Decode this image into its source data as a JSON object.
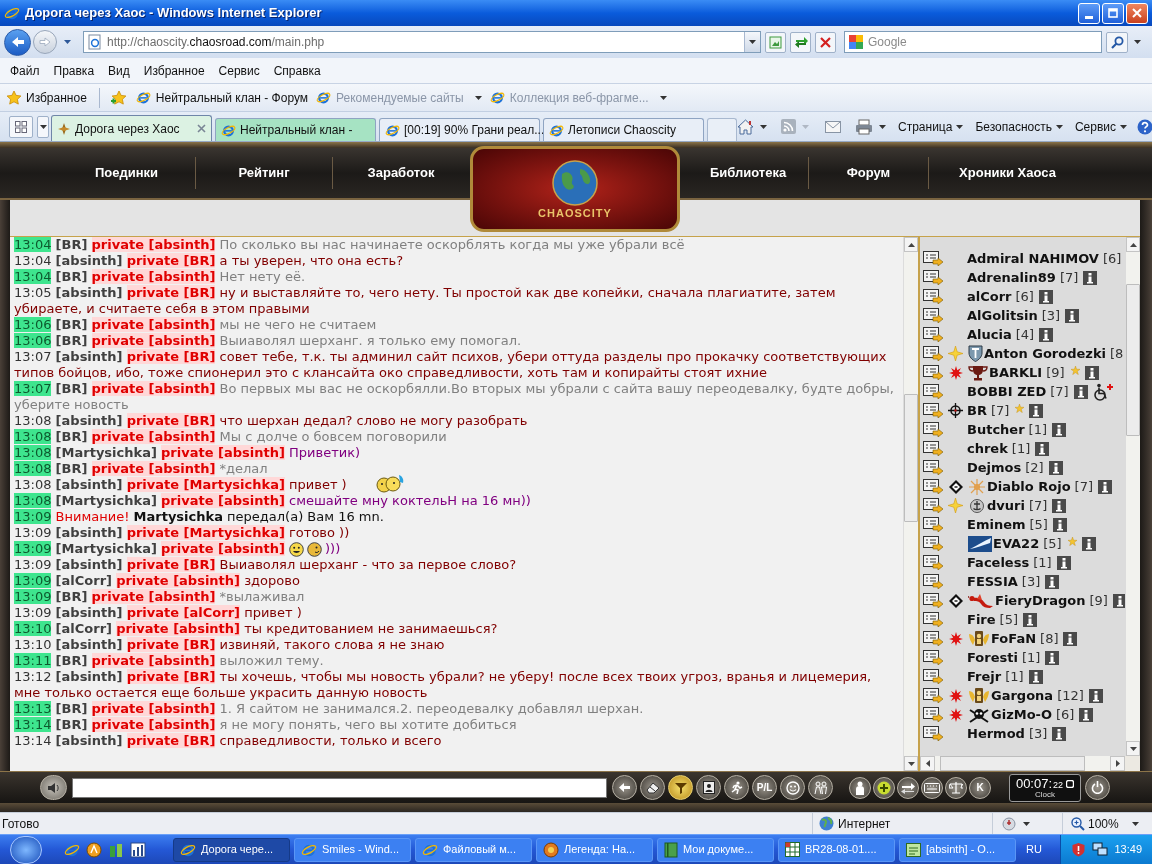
{
  "window": {
    "title": "Дорога через Хаос - Windows Internet Explorer"
  },
  "address_bar": {
    "url": {
      "start": "http://chaoscity.",
      "domain": "chaosroad.com",
      "path": "/main.php"
    },
    "search": {
      "placeholder": "Google"
    }
  },
  "menu": [
    "Файл",
    "Правка",
    "Вид",
    "Избранное",
    "Сервис",
    "Справка"
  ],
  "favorites_bar": {
    "favorites_button": "Избранное",
    "links": [
      {
        "label": "Нейтральный клан - Форум",
        "disabled": false,
        "dropdown": false
      },
      {
        "label": "Рекомендуемые сайты",
        "disabled": true,
        "dropdown": true
      },
      {
        "label": "Коллекция веб-фрагме...",
        "disabled": true,
        "dropdown": true
      }
    ]
  },
  "tabs": [
    {
      "label": "Дорога через Хаос",
      "selected": true,
      "color": "#dcf2e3"
    },
    {
      "label": "Нейтральный клан -",
      "selected": false,
      "color": "#a6e3c3"
    },
    {
      "label": "[00:19] 90% Грани реал...",
      "selected": false,
      "color": "#e8eef7"
    },
    {
      "label": "Летописи Chaoscity",
      "selected": false,
      "color": "#e8eef7"
    }
  ],
  "command_bar": [
    "Страница",
    "Безопасность",
    "Сервис"
  ],
  "game": {
    "nav_left": [
      "Поединки",
      "Рейтинг",
      "Заработок"
    ],
    "logo": "CHAOSCITY",
    "nav_right": [
      "Библиотека",
      "Форум",
      "Хроники Хаоса"
    ],
    "chat": [
      {
        "kind": "private",
        "time": "13:04",
        "highlighted": true,
        "from": "[BR]",
        "to": "private [absinth]",
        "text": "По сколько вы нас начинаете оскорблять когда мы уже убрали всё",
        "color": "#808080"
      },
      {
        "kind": "private",
        "time": "13:04",
        "highlighted": false,
        "from": "[absinth]",
        "to": "private [BR]",
        "text": "а ты уверен, что она есть?",
        "color": "#800000"
      },
      {
        "kind": "private",
        "time": "13:04",
        "highlighted": true,
        "from": "[BR]",
        "to": "private [absinth]",
        "text": "Нет нету её.",
        "color": "#808080"
      },
      {
        "kind": "private",
        "time": "13:05",
        "highlighted": false,
        "from": "[absinth]",
        "to": "private [BR]",
        "text": "ну и выставляйте то, чего нету. Ты простой как две копейки, сначала плагиатите, затем убираете, и считаете себя в этом правыми",
        "color": "#800000"
      },
      {
        "kind": "private",
        "time": "13:06",
        "highlighted": true,
        "from": "[BR]",
        "to": "private [absinth]",
        "text": "мы не чего не считаем",
        "color": "#808080"
      },
      {
        "kind": "private",
        "time": "13:06",
        "highlighted": true,
        "from": "[BR]",
        "to": "private [absinth]",
        "text": "Выиаволял шерханг. я только ему помогал.",
        "color": "#808080"
      },
      {
        "kind": "private",
        "time": "13:07",
        "highlighted": false,
        "from": "[absinth]",
        "to": "private [BR]",
        "text": "совет тебе, т.к. ты админил сайт психов, убери оттуда разделы про прокачку соответствующих типов бойцов, ибо, тоже спионерил это с клансайта око справедливости, хоть там и копирайты стоят ихние",
        "color": "#800000"
      },
      {
        "kind": "private",
        "time": "13:07",
        "highlighted": true,
        "from": "[BR]",
        "to": "private [absinth]",
        "text": "Во первых мы вас не оскорбялли.Во вторых мы убрали с сайта вашу переодевалку, будте добры, уберите новость",
        "color": "#808080"
      },
      {
        "kind": "private",
        "time": "13:08",
        "highlighted": false,
        "from": "[absinth]",
        "to": "private [BR]",
        "text": "что шерхан дедал? слово не могу разобрать",
        "color": "#800000"
      },
      {
        "kind": "private",
        "time": "13:08",
        "highlighted": true,
        "from": "[BR]",
        "to": "private [absinth]",
        "text": "Мы с долче о бовсем поговорили",
        "color": "#808080"
      },
      {
        "kind": "private",
        "time": "13:08",
        "highlighted": true,
        "from": "[Martysichka]",
        "to": "private [absinth]",
        "text": "Приветик)",
        "color": "#800080"
      },
      {
        "kind": "private",
        "time": "13:08",
        "highlighted": true,
        "from": "[BR]",
        "to": "private [absinth]",
        "text": "*делал",
        "color": "#808080"
      },
      {
        "kind": "private",
        "time": "13:08",
        "highlighted": false,
        "from": "[absinth]",
        "to": "private [Martysichka]",
        "parts": [
          {
            "kind": "text",
            "text": "привет )"
          },
          {
            "kind": "hug"
          }
        ],
        "color": "#800000"
      },
      {
        "kind": "private",
        "time": "13:08",
        "highlighted": true,
        "from": "[Martysichka]",
        "to": "private [absinth]",
        "text": "смешайте мну коктельН на 16 мн))",
        "color": "#800080"
      },
      {
        "kind": "system",
        "time": "13:09",
        "highlighted": true,
        "alert": "Внимание!",
        "text": "**Martysichka** передал(а) Вам 16 mn."
      },
      {
        "kind": "private",
        "time": "13:09",
        "highlighted": false,
        "from": "[absinth]",
        "to": "private [Martysichka]",
        "text": "готово ))",
        "color": "#800000"
      },
      {
        "kind": "private",
        "time": "13:09",
        "highlighted": true,
        "from": "[Martysichka]",
        "to": "private [absinth]",
        "parts": [
          {
            "kind": "grin"
          },
          {
            "kind": "face"
          },
          {
            "kind": "text",
            "text": ")))"
          }
        ],
        "color": "#800080"
      },
      {
        "kind": "private",
        "time": "13:09",
        "highlighted": false,
        "from": "[absinth]",
        "to": "private [BR]",
        "text": "Выиаволял шерханг - что за первое слово?",
        "color": "#800000"
      },
      {
        "kind": "private",
        "time": "13:09",
        "highlighted": true,
        "from": "[alCorr]",
        "to": "private [absinth]",
        "text": "здорово",
        "color": "#800000"
      },
      {
        "kind": "private",
        "time": "13:09",
        "highlighted": true,
        "from": "[BR]",
        "to": "private [absinth]",
        "text": "*вылаживал",
        "color": "#808080"
      },
      {
        "kind": "private",
        "time": "13:09",
        "highlighted": false,
        "from": "[absinth]",
        "to": "private [alCorr]",
        "text": "привет )",
        "color": "#800000"
      },
      {
        "kind": "private",
        "time": "13:10",
        "highlighted": true,
        "from": "[alCorr]",
        "to": "private [absinth]",
        "text": "ты кредитованием не занимаешься?",
        "color": "#800000"
      },
      {
        "kind": "private",
        "time": "13:10",
        "highlighted": false,
        "from": "[absinth]",
        "to": "private [BR]",
        "text": "извиняй, такого слова я не знаю",
        "color": "#800000"
      },
      {
        "kind": "private",
        "time": "13:11",
        "highlighted": true,
        "from": "[BR]",
        "to": "private [absinth]",
        "text": "выложил тему.",
        "color": "#808080"
      },
      {
        "kind": "private",
        "time": "13:12",
        "highlighted": false,
        "from": "[absinth]",
        "to": "private [BR]",
        "text": "ты хочешь, чтобы мы новость убрали? не уберу! после всех твоих угроз, вранья и лицемерия, мне только остается еще больше украсить данную новость",
        "color": "#800000"
      },
      {
        "kind": "private",
        "time": "13:13",
        "highlighted": true,
        "from": "[BR]",
        "to": "private [absinth]",
        "text": "1. Я сайтом не занимался.2. переодевалку добавлял шерхан.",
        "color": "#808080"
      },
      {
        "kind": "private",
        "time": "13:14",
        "highlighted": true,
        "from": "[BR]",
        "to": "private [absinth]",
        "text": "я не могу понять, чего вы хотите добиться",
        "color": "#808080"
      },
      {
        "kind": "private",
        "time": "13:14",
        "highlighted": false,
        "from": "[absinth]",
        "to": "private [BR]",
        "text": "справедливости, только и всего",
        "color": "#800000"
      }
    ],
    "users": [
      {
        "name": "Admiral NAHIMOV",
        "rank": "[6]"
      },
      {
        "name": "Adrenalin89",
        "rank": "[7]",
        "marks": [
          {
            "kind": "info"
          }
        ]
      },
      {
        "name": "alCorr",
        "rank": "[6]",
        "marks": [
          {
            "kind": "info"
          }
        ]
      },
      {
        "name": "AlGolitsin",
        "rank": "[3]",
        "marks": [
          {
            "kind": "info"
          }
        ]
      },
      {
        "name": "Alucia",
        "rank": "[4]",
        "marks": [
          {
            "kind": "info"
          }
        ]
      },
      {
        "name": "Anton Gorodezki",
        "rank": "[8",
        "badge": {
          "kind": "sparkle"
        },
        "emblem": {
          "kind": "shield"
        }
      },
      {
        "name": "BARKLI",
        "rank": "[9]",
        "badge": {
          "kind": "burst"
        },
        "emblem": {
          "kind": "trophy"
        },
        "marks": [
          {
            "kind": "star"
          },
          {
            "kind": "info"
          }
        ]
      },
      {
        "name": "BOBBI ZED",
        "rank": "[7]",
        "marks": [
          {
            "kind": "info"
          },
          {
            "kind": "wheelchair"
          }
        ]
      },
      {
        "name": "BR",
        "rank": "[7]",
        "badge": {
          "kind": "crosshair"
        },
        "marks": [
          {
            "kind": "star"
          },
          {
            "kind": "info"
          }
        ]
      },
      {
        "name": "Butcher",
        "rank": "[1]",
        "marks": [
          {
            "kind": "info"
          }
        ]
      },
      {
        "name": "chrek",
        "rank": "[1]",
        "marks": [
          {
            "kind": "info"
          }
        ]
      },
      {
        "name": "Dejmos",
        "rank": "[2]",
        "marks": [
          {
            "kind": "info"
          }
        ]
      },
      {
        "name": "Diablo Rojo",
        "rank": "[7]",
        "badge": {
          "kind": "diamond"
        },
        "emblem": {
          "kind": "sunburst"
        },
        "marks": [
          {
            "kind": "info"
          }
        ]
      },
      {
        "name": "dvuri",
        "rank": "[7]",
        "badge": {
          "kind": "sparkle"
        },
        "emblem": {
          "kind": "anchor"
        },
        "marks": [
          {
            "kind": "info"
          }
        ]
      },
      {
        "name": "Eminem",
        "rank": "[5]",
        "marks": [
          {
            "kind": "info"
          }
        ]
      },
      {
        "name": "EVA22",
        "rank": "[5]",
        "emblem": {
          "kind": "streak"
        },
        "marks": [
          {
            "kind": "star"
          },
          {
            "kind": "info"
          }
        ]
      },
      {
        "name": "Faceless",
        "rank": "[1]",
        "marks": [
          {
            "kind": "info"
          }
        ]
      },
      {
        "name": "FESSIA",
        "rank": "[3]",
        "marks": [
          {
            "kind": "info"
          }
        ]
      },
      {
        "name": "FieryDragon",
        "rank": "[9]",
        "badge": {
          "kind": "diamond"
        },
        "emblem": {
          "kind": "dragon"
        },
        "marks": [
          {
            "kind": "info"
          }
        ]
      },
      {
        "name": "Fire",
        "rank": "[5]",
        "marks": [
          {
            "kind": "info"
          }
        ]
      },
      {
        "name": "FoFaN",
        "rank": "[8]",
        "badge": {
          "kind": "burst"
        },
        "emblem": {
          "kind": "winged"
        },
        "marks": [
          {
            "kind": "info"
          }
        ]
      },
      {
        "name": "Foresti",
        "rank": "[1]",
        "marks": [
          {
            "kind": "info"
          }
        ]
      },
      {
        "name": "Frejr",
        "rank": "[1]",
        "marks": [
          {
            "kind": "info"
          }
        ]
      },
      {
        "name": "Gargona",
        "rank": "[12]",
        "badge": {
          "kind": "burst"
        },
        "emblem": {
          "kind": "winged"
        },
        "marks": [
          {
            "kind": "info"
          }
        ]
      },
      {
        "name": "GizMo-O",
        "rank": "[6]",
        "badge": {
          "kind": "burst"
        },
        "emblem": {
          "kind": "skull"
        },
        "marks": [
          {
            "kind": "info"
          }
        ]
      },
      {
        "name": "Hermod",
        "rank": "[3]",
        "marks": [
          {
            "kind": "info"
          }
        ]
      }
    ],
    "toolbar_left": [
      {
        "kind": "back",
        "selected": false
      },
      {
        "kind": "eraser",
        "selected": false
      },
      {
        "kind": "filter",
        "selected": true
      },
      {
        "kind": "card",
        "selected": false
      },
      {
        "kind": "runner",
        "selected": false
      },
      {
        "kind": "text",
        "label": "P/L",
        "selected": false
      },
      {
        "kind": "smiley",
        "selected": false
      },
      {
        "kind": "people",
        "selected": false
      }
    ],
    "toolbar_right": [
      {
        "kind": "person",
        "selected": false
      },
      {
        "kind": "plus",
        "selected": false
      },
      {
        "kind": "swap",
        "selected": false
      },
      {
        "kind": "keyboard",
        "selected": false
      },
      {
        "kind": "scales",
        "selected": false
      },
      {
        "kind": "text",
        "label": "K",
        "selected": false
      }
    ],
    "clock": {
      "time": "00:07:",
      "seconds": "22",
      "label": "Clock"
    }
  },
  "status_bar": {
    "text": "Готово",
    "zone": "Интернет",
    "zoom": "100%"
  },
  "taskbar": {
    "tasks": [
      {
        "label": "Дорога чере...",
        "kind": "ie",
        "selected": true
      },
      {
        "label": "Smiles - Wind...",
        "kind": "ie",
        "selected": false
      },
      {
        "label": "Файловый м...",
        "kind": "ie",
        "selected": false
      },
      {
        "label": "Легенда: На...",
        "kind": "game",
        "selected": false
      },
      {
        "label": "Мои докуме...",
        "kind": "book",
        "selected": false
      },
      {
        "label": "BR28-08-01....",
        "kind": "sheet",
        "selected": false
      },
      {
        "label": "[absinth] - O...",
        "kind": "note",
        "selected": false
      }
    ],
    "language": "RU",
    "time": "13:49"
  }
}
